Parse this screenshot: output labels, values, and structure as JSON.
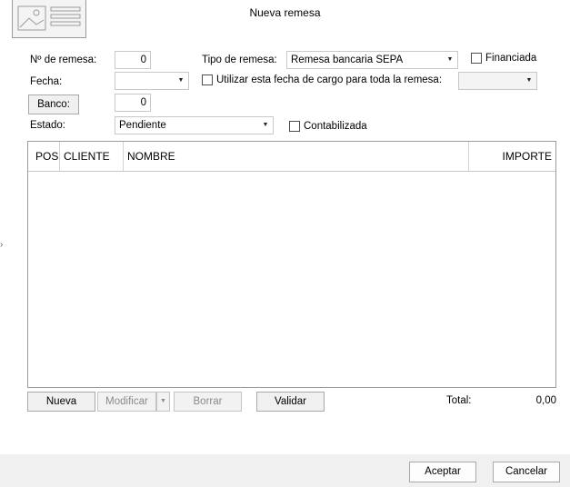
{
  "window": {
    "title": "Nueva remesa"
  },
  "form": {
    "numero_label": "Nº de remesa:",
    "numero_value": "0",
    "tipo_label": "Tipo de remesa:",
    "tipo_value": "Remesa bancaria SEPA",
    "financiada_label": "Financiada",
    "fecha_label": "Fecha:",
    "fecha_value": "",
    "utilizar_label": "Utilizar esta fecha de cargo para toda la remesa:",
    "utilizar_value": "",
    "banco_button": "Banco:",
    "banco_value": "0",
    "estado_label": "Estado:",
    "estado_value": "Pendiente",
    "contabilizada_label": "Contabilizada"
  },
  "table": {
    "columns": [
      "POS",
      "CLIENTE",
      "NOMBRE",
      "IMPORTE"
    ],
    "rows": []
  },
  "actions": {
    "nueva": "Nueva",
    "modificar": "Modificar",
    "borrar": "Borrar",
    "validar": "Validar",
    "total_label": "Total:",
    "total_value": "0,00"
  },
  "footer": {
    "aceptar": "Aceptar",
    "cancelar": "Cancelar"
  },
  "icons": {
    "dropdown": "triangle-down",
    "thumbnail": "image-document-thumbnail",
    "side_arrow": "chevron-right"
  }
}
